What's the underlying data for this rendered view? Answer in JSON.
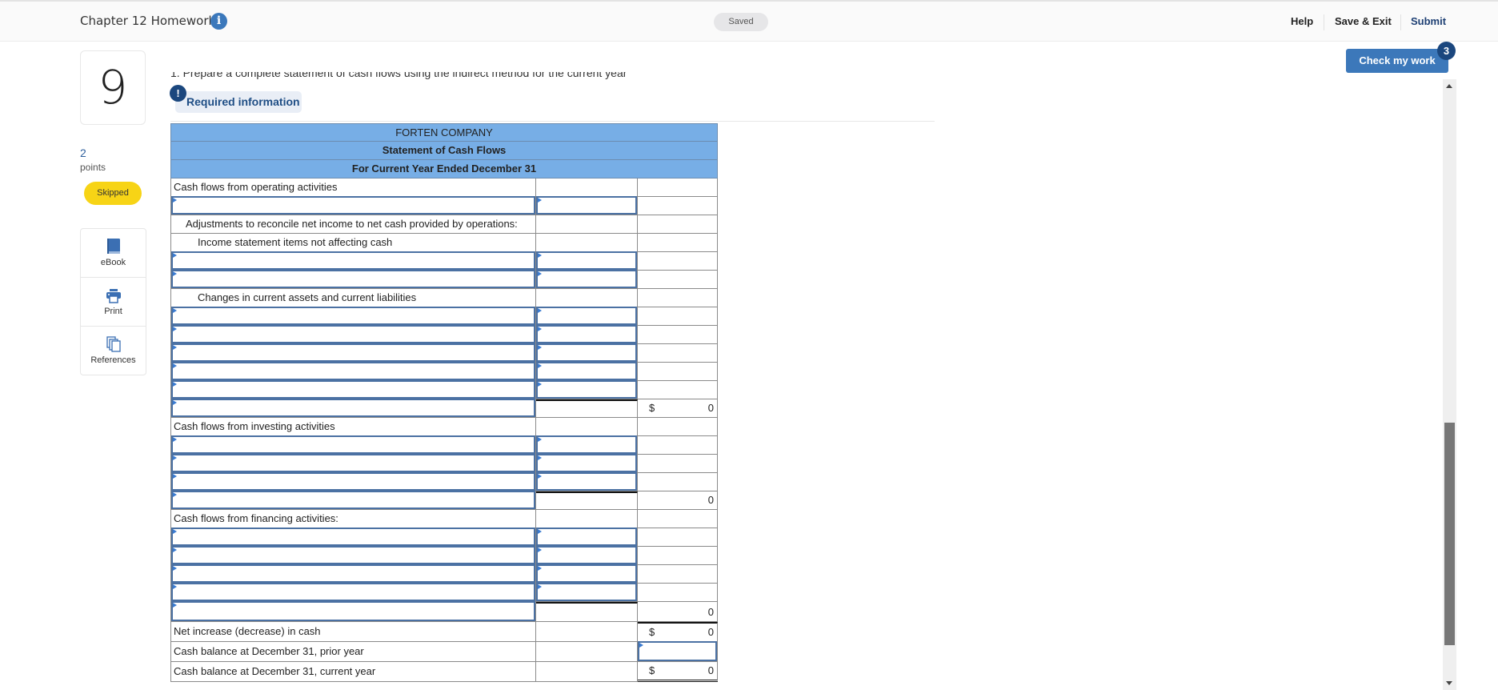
{
  "header": {
    "title": "Chapter 12 Homework",
    "info_icon": "info-icon",
    "status": "Saved",
    "nav": {
      "help": "Help",
      "save_exit": "Save & Exit",
      "submit": "Submit"
    },
    "check_my_work": "Check my work",
    "check_badge": "3"
  },
  "question": {
    "number": "9",
    "points_value": "2",
    "points_label": "points",
    "status": "Skipped",
    "prompt": "1. Prepare a complete statement of cash flows using the indirect method for the current year",
    "required_info": "Required information",
    "required_icon": "!"
  },
  "tools": [
    {
      "icon": "book-icon",
      "label": "eBook"
    },
    {
      "icon": "printer-icon",
      "label": "Print"
    },
    {
      "icon": "references-icon",
      "label": "References"
    }
  ],
  "statement": {
    "company": "FORTEN COMPANY",
    "title": "Statement of Cash Flows",
    "period": "For Current Year Ended December 31",
    "operating_label": "Cash flows from operating activities",
    "adjustments_label": "Adjustments to reconcile net income to net cash provided by operations:",
    "noncash_label": "Income statement items not affecting cash",
    "changes_label": "Changes in current assets and current liabilities",
    "operating_total": {
      "currency": "$",
      "value": "0"
    },
    "investing_label": "Cash flows from investing activities",
    "investing_total": {
      "value": "0"
    },
    "financing_label": "Cash flows from financing activities:",
    "financing_total": {
      "value": "0"
    },
    "net_change_label": "Net increase (decrease) in cash",
    "net_change": {
      "currency": "$",
      "value": "0"
    },
    "prior_balance_label": "Cash balance at December 31, prior year",
    "prior_balance_value": "",
    "current_balance_label": "Cash balance at December 31, current year",
    "current_balance": {
      "currency": "$",
      "value": "0"
    }
  }
}
